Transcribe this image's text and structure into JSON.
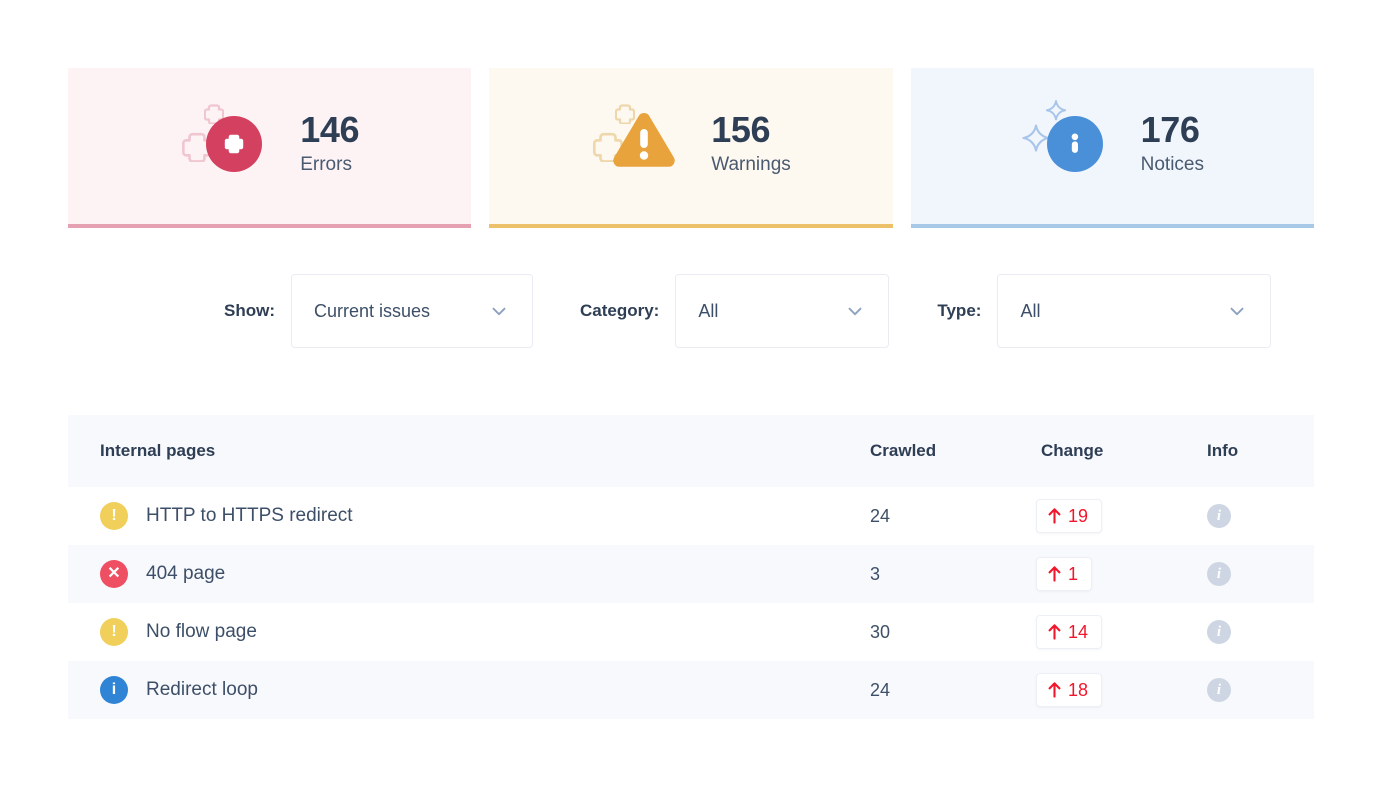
{
  "summary_cards": [
    {
      "id": "errors",
      "count": "146",
      "label": "Errors",
      "icon": "error-circle-icon",
      "accent": "#d4405f",
      "bg": "#fdf3f5",
      "border": "#e5a0b2"
    },
    {
      "id": "warnings",
      "count": "156",
      "label": "Warnings",
      "icon": "warning-triangle-icon",
      "accent": "#e8a33d",
      "bg": "#fdf8f0",
      "border": "#edc169"
    },
    {
      "id": "notices",
      "count": "176",
      "label": "Notices",
      "icon": "info-circle-icon",
      "accent": "#4a90d9",
      "bg": "#f1f5fc",
      "border": "#a8c8e8"
    }
  ],
  "filters": [
    {
      "id": "show",
      "label": "Show:",
      "value": "Current issues"
    },
    {
      "id": "category",
      "label": "Category:",
      "value": "All"
    },
    {
      "id": "type",
      "label": "Type:",
      "value": "All"
    }
  ],
  "table": {
    "headers": {
      "name": "Internal pages",
      "crawled": "Crawled",
      "change": "Change",
      "info": "Info"
    },
    "rows": [
      {
        "severity": "warning",
        "name": "HTTP to HTTPS redirect",
        "crawled": "24",
        "change": "19",
        "change_dir": "up",
        "info": "info-icon"
      },
      {
        "severity": "error",
        "name": "404 page",
        "crawled": "3",
        "change": "1",
        "change_dir": "up",
        "info": "info-icon"
      },
      {
        "severity": "warning",
        "name": "No flow page",
        "crawled": "30",
        "change": "14",
        "change_dir": "up",
        "info": "info-icon"
      },
      {
        "severity": "notice",
        "name": "Redirect loop",
        "crawled": "24",
        "change": "18",
        "change_dir": "up",
        "info": "info-icon"
      }
    ]
  },
  "colors": {
    "error_red": "#ee4f62",
    "warning_yellow": "#f1cf5b",
    "notice_blue": "#2f84d6",
    "change_red": "#f2162c",
    "text_dark": "#2e3e55",
    "row_alt_bg": "#f8f9fc"
  }
}
